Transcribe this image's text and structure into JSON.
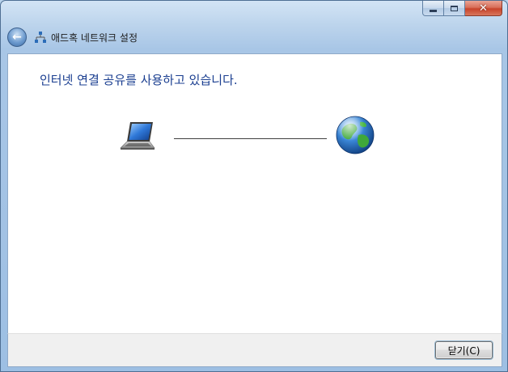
{
  "window": {
    "title": "애드혹 네트워크 설정",
    "caption_buttons": {
      "minimize": "minimize",
      "maximize": "maximize",
      "close": "✕"
    }
  },
  "main": {
    "heading": "인터넷 연결 공유를 사용하고 있습니다.",
    "diagram": {
      "left_icon": "laptop-icon",
      "right_icon": "globe-icon"
    }
  },
  "footer": {
    "close_button_label": "닫기(C)"
  },
  "colors": {
    "heading": "#1a3e90",
    "window_frame": "#a8c6e6",
    "content_bg": "#ffffff",
    "footer_bg": "#f0f0f0"
  }
}
